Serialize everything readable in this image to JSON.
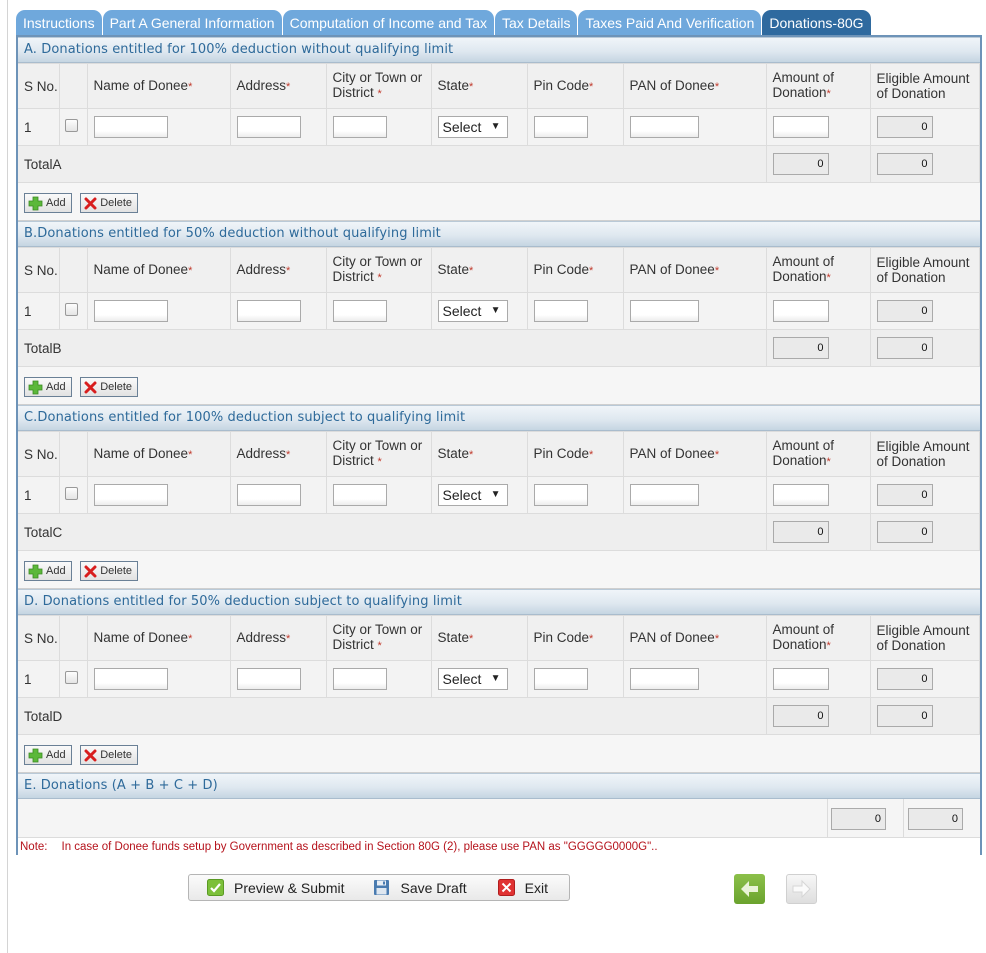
{
  "tabs": [
    {
      "label": "Instructions",
      "active": false
    },
    {
      "label": "Part A General Information",
      "active": false
    },
    {
      "label": "Computation of Income and Tax",
      "active": false
    },
    {
      "label": "Tax Details",
      "active": false
    },
    {
      "label": "Taxes Paid And Verification",
      "active": false
    },
    {
      "label": "Donations-80G",
      "active": true
    }
  ],
  "columns": {
    "sno": "S No.",
    "name": "Name of Donee",
    "address": "Address",
    "city": "City or Town or District",
    "state": "State",
    "pin": "Pin Code",
    "pan": "PAN of Donee",
    "amount": "Amount of Donation",
    "eligible": "Eligible Amount of Donation",
    "required_mark": "*"
  },
  "sections": [
    {
      "title": "A. Donations entitled for 100% deduction without qualifying limit",
      "rows": [
        {
          "sno": "1",
          "name": "",
          "address": "",
          "city": "",
          "state": "Select",
          "pin": "",
          "pan": "",
          "amount": "",
          "eligible": "0"
        }
      ],
      "total_label": "TotalA",
      "total_amount": "0",
      "total_eligible": "0"
    },
    {
      "title": "B.Donations entitled for 50% deduction without qualifying limit",
      "rows": [
        {
          "sno": "1",
          "name": "",
          "address": "",
          "city": "",
          "state": "Select",
          "pin": "",
          "pan": "",
          "amount": "",
          "eligible": "0"
        }
      ],
      "total_label": "TotalB",
      "total_amount": "0",
      "total_eligible": "0"
    },
    {
      "title": "C.Donations entitled for 100% deduction subject to qualifying limit",
      "rows": [
        {
          "sno": "1",
          "name": "",
          "address": "",
          "city": "",
          "state": "Select",
          "pin": "",
          "pan": "",
          "amount": "",
          "eligible": "0"
        }
      ],
      "total_label": "TotalC",
      "total_amount": "0",
      "total_eligible": "0"
    },
    {
      "title": "D. Donations entitled for 50% deduction subject to qualifying limit",
      "rows": [
        {
          "sno": "1",
          "name": "",
          "address": "",
          "city": "",
          "state": "Select",
          "pin": "",
          "pan": "",
          "amount": "",
          "eligible": "0"
        }
      ],
      "total_label": "TotalD",
      "total_amount": "0",
      "total_eligible": "0"
    }
  ],
  "row_buttons": {
    "add": "Add",
    "delete": "Delete"
  },
  "section_e": {
    "title": "E. Donations (A + B + C + D)",
    "total_amount": "0",
    "total_eligible": "0"
  },
  "note": {
    "label": "Note:",
    "text": "In case of Donee funds setup by Government as described in Section 80G (2), please use PAN as \"GGGGG0000G\".."
  },
  "footer": {
    "preview_submit": "Preview & Submit",
    "save_draft": "Save Draft",
    "exit": "Exit"
  },
  "nav": {
    "previous": "previous-page",
    "next": "next-page"
  },
  "colors": {
    "tab": "#6fa8dc",
    "tab_active": "#2f6a9f",
    "section_title": "#2e6a9a",
    "note": "#b5121b",
    "panel_border": "#6d93b8"
  }
}
